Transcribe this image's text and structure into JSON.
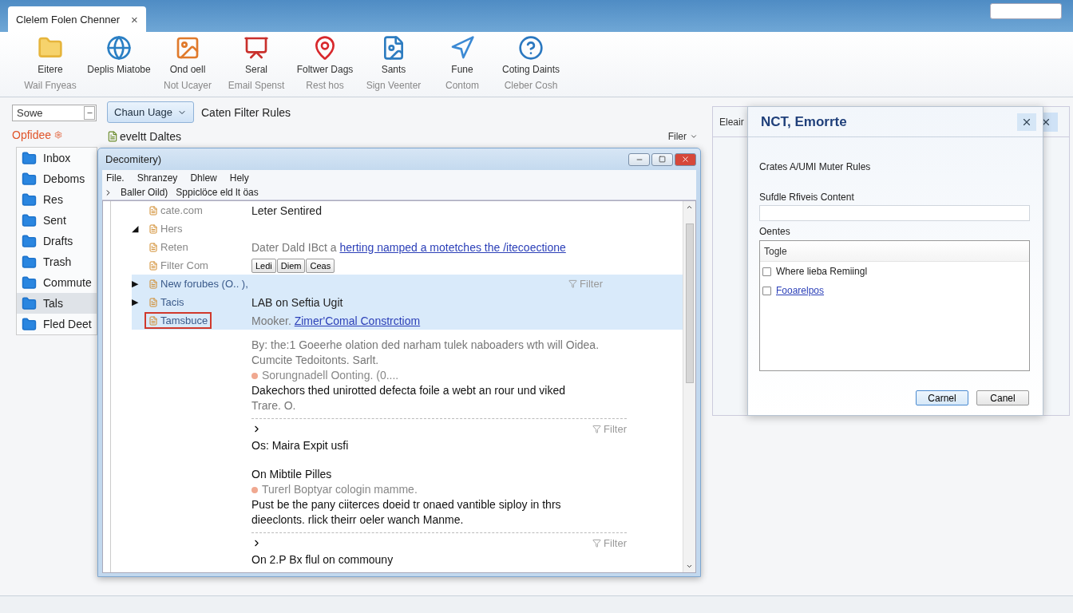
{
  "tab": {
    "title": "Clelem Folen Chenner",
    "close": "×"
  },
  "toolbar": [
    {
      "label": "Eitere",
      "sublabel": "Wail Fnyeas"
    },
    {
      "label": "Deplis Miatobe"
    },
    {
      "label": "Ond oell",
      "sublabel": "Not Ucayer"
    },
    {
      "label": "Seral",
      "sublabel": "Email Spenst"
    },
    {
      "label": "Foltwer Dags",
      "sublabel": "Rest hos"
    },
    {
      "label": "Sants",
      "sublabel": "Sign Veenter"
    },
    {
      "label": "Fune",
      "sublabel": "Contom"
    },
    {
      "label": "Coting Daints",
      "sublabel": "Cleber Cosh"
    }
  ],
  "controls": {
    "select_value": "Sowe",
    "dropdown": "Chaun Uage",
    "title": "Caten Filter Rules",
    "section": "Opfidee",
    "subheader": "eveltt Daltes",
    "filter_menu": "Filer"
  },
  "sidebar": [
    {
      "label": "Inbox",
      "selected": false
    },
    {
      "label": "Deboms",
      "selected": false
    },
    {
      "label": "Res",
      "selected": false
    },
    {
      "label": "Sent",
      "selected": false
    },
    {
      "label": "Drafts",
      "selected": false
    },
    {
      "label": "Trash",
      "selected": false
    },
    {
      "label": "Commute",
      "selected": false
    },
    {
      "label": "Tals",
      "selected": true
    },
    {
      "label": "Fled Deet",
      "selected": false
    }
  ],
  "dialog": {
    "title": "Decomitery)",
    "menu": [
      "File.",
      "Shranzey",
      "Dhlew",
      "Hely"
    ],
    "breadcrumb": [
      "Baller Oild)",
      "Sppiclöce eld lt öas"
    ],
    "tree": [
      {
        "label": "cate.com",
        "text": "Leter Sentired",
        "selected": false,
        "flagged": false
      },
      {
        "label": "Hers",
        "arrow": "◢",
        "selected": false,
        "flagged": false
      },
      {
        "label": "Reten",
        "text": "Dater Dald IBct a",
        "link": "herting namped a motetches the /itecoectione",
        "selected": false,
        "flagged": false
      },
      {
        "label": "Filter Com",
        "buttons": [
          "Ledi",
          "Diem",
          "Ceas"
        ],
        "selected": false,
        "flagged": false
      },
      {
        "label": "New forubes (O.. ),",
        "arrow": "▶",
        "tag": "Filter",
        "selected": true,
        "flagged": false
      },
      {
        "label": "Tacis",
        "arrow": "▶",
        "text": "LAB on Seftia Ugit",
        "selected": true,
        "flagged": false
      },
      {
        "label": "Tamsbuce",
        "text": "Mooker.",
        "link": "Zimer'Comal Constrctiom",
        "selected": true,
        "flagged": true
      }
    ],
    "feed": [
      {
        "kind": "faded",
        "text": "By: the:1 Goeerhe olation ded narham tulek naboaders wth will Oidea. Cumcite Tedoitonts. Sarlt."
      },
      {
        "kind": "meta",
        "text": "Sorungnadell Oonting. (0...."
      },
      {
        "kind": "body",
        "text": "Dakechors thed unirotted defecta foile a webt an rour und viked"
      },
      {
        "kind": "faded",
        "text": "Trare. O."
      },
      {
        "kind": "divider",
        "tag": "Filter"
      },
      {
        "kind": "body",
        "text": "Os: Maira Expit usfi"
      },
      {
        "kind": "title",
        "text": "On Mibtile Pilles"
      },
      {
        "kind": "meta",
        "text": "Turerl Boptyar cologin mamme."
      },
      {
        "kind": "body",
        "text": "Pust be the pany ciiterces doeid tr onaed vantible siploy in thrs dieeclonts. rlick theirr oeler wanch Manme."
      },
      {
        "kind": "divider",
        "tag": "Filter"
      },
      {
        "kind": "body",
        "text": "On 2.P Bx flul on commouny"
      }
    ]
  },
  "side_panel": {
    "title": "Eleair"
  },
  "rule_dialog": {
    "title": "NCT, Emorrte",
    "heading": "Crates A/UMI Muter Rules",
    "field_label": "Sufdle Rfiveis Content",
    "list_label": "Oentes",
    "list_header": "Togle",
    "options": [
      {
        "label": "Where lieba Remiingl",
        "checked": false,
        "kind": "plain"
      },
      {
        "label": "Fooarelpos",
        "checked": false,
        "kind": "link"
      }
    ],
    "buttons": [
      {
        "label": "Carnel",
        "primary": true
      },
      {
        "label": "Canel",
        "primary": false
      }
    ]
  }
}
